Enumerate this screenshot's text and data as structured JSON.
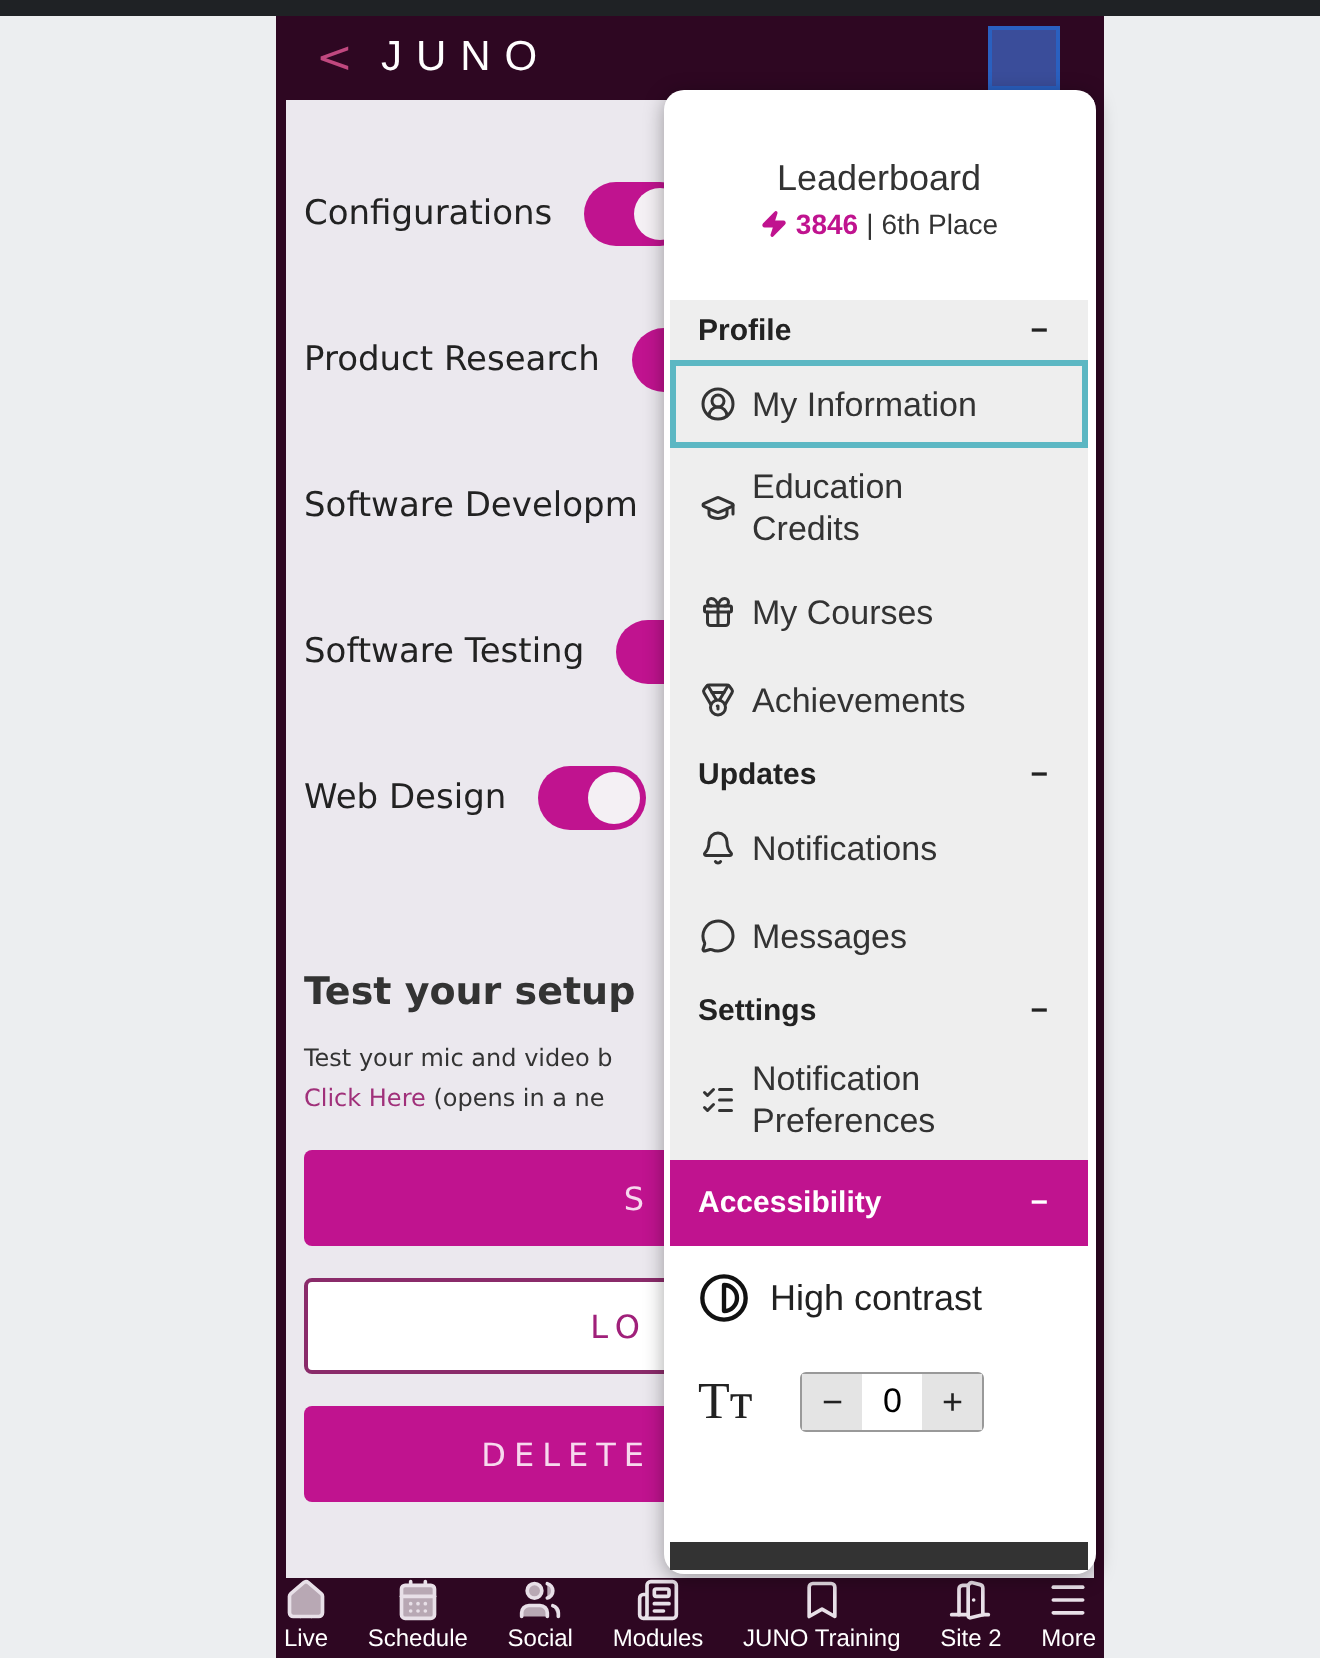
{
  "header": {
    "back": "<",
    "logo": "JUNO"
  },
  "topics": [
    {
      "label": "Configurations",
      "on": true
    },
    {
      "label": "Product Research",
      "on": true
    },
    {
      "label": "Software Developm"
    },
    {
      "label": "Software Testing",
      "on": true
    },
    {
      "label": "Web Design",
      "on": true
    }
  ],
  "setup": {
    "title": "Test your setup",
    "line1": "Test your mic and video b",
    "link": "Click Here",
    "line2": " (opens in a ne"
  },
  "buttons": [
    {
      "label": "S",
      "kind": "filled"
    },
    {
      "label": "LO",
      "kind": "outline"
    },
    {
      "label": "DELETE",
      "kind": "filled"
    }
  ],
  "menu": {
    "title": "Leaderboard",
    "points": "3846",
    "separator": "|",
    "place": "6th Place",
    "sections": [
      {
        "title": "Profile",
        "toggle": "−",
        "highlighted": false,
        "items": [
          {
            "label": "My Information",
            "selected": true
          },
          {
            "label": "Education Credits",
            "selected": false
          },
          {
            "label": "My Courses",
            "selected": false
          },
          {
            "label": "Achievements",
            "selected": false
          }
        ]
      },
      {
        "title": "Updates",
        "toggle": "−",
        "highlighted": false,
        "items": [
          {
            "label": "Notifications",
            "selected": false
          },
          {
            "label": "Messages",
            "selected": false
          }
        ]
      },
      {
        "title": "Settings",
        "toggle": "−",
        "highlighted": false,
        "items": [
          {
            "label": "Notification Preferences",
            "selected": false
          }
        ]
      },
      {
        "title": "Accessibility",
        "toggle": "−",
        "highlighted": true
      }
    ],
    "contrast": "High contrast",
    "text_size": "Tт",
    "stepper": {
      "minus": "−",
      "value": "0",
      "plus": "+"
    }
  },
  "nav": [
    "Live",
    "Schedule",
    "Social",
    "Modules",
    "JUNO Training",
    "Site 2",
    "More"
  ]
}
